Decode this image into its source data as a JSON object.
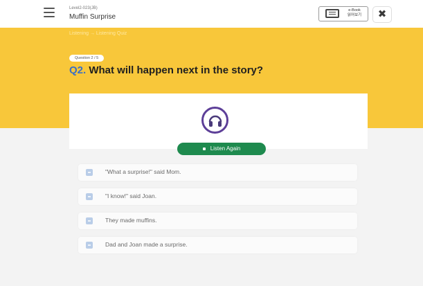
{
  "header": {
    "level_label": "Level2-023(JB)",
    "book_title": "Muffin Surprise",
    "ebook_label_line1": "e-Book",
    "ebook_label_line2": "읽어보기",
    "close_icon": "✖"
  },
  "breadcrumb": "Listening  →  Listening Quiz",
  "question": {
    "badge": "Question 2 / 5",
    "number": "Q2.",
    "text": "What will happen next in the story?"
  },
  "audio": {
    "icon": "headphones-icon",
    "listen_again_label": "Listen Again"
  },
  "options": [
    {
      "text": "\"What a surprise!\" said Mom."
    },
    {
      "text": "\"I know!\" said Joan."
    },
    {
      "text": "They made muffins."
    },
    {
      "text": "Dad and Joan made a surprise."
    }
  ],
  "colors": {
    "accent_yellow": "#f8c73a",
    "question_number": "#3a6fc4",
    "listen_button": "#1e8a4e",
    "headphone_ring": "#5d3f98"
  }
}
